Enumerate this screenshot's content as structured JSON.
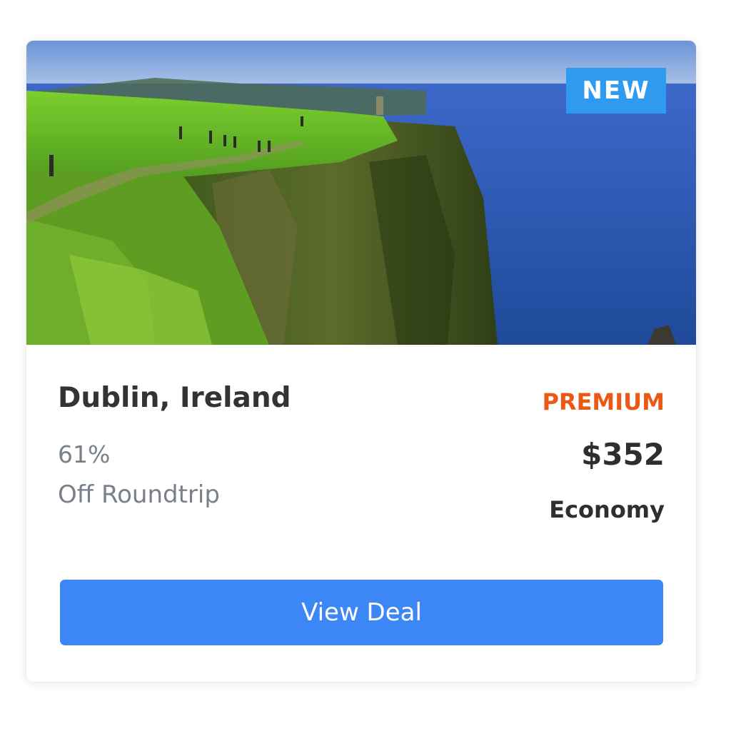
{
  "deal_card": {
    "badge": "NEW",
    "destination": "Dublin, Ireland",
    "discount": "61%",
    "trip_type": "Off Roundtrip",
    "tier": "PREMIUM",
    "price": "$352",
    "cabin_class": "Economy",
    "cta_label": "View Deal"
  },
  "colors": {
    "badge_bg": "#2f9bf0",
    "tier_text": "#ea5a14",
    "cta_bg": "#3d86f5"
  }
}
